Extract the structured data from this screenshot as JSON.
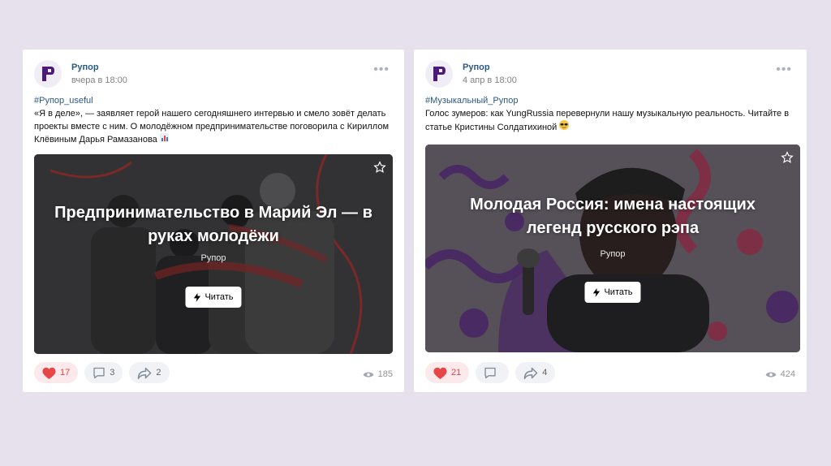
{
  "colors": {
    "accent": "#2a5885",
    "like": "#e64646",
    "brand": "#4b1a7a"
  },
  "posts": [
    {
      "author": "Рупор",
      "time": "вчера в 18:00",
      "hashtag": "#Рупор_useful",
      "text": "«Я в деле», — заявляет герой нашего сегодняшнего интервью и смело зовёт делать проекты вместе с ним. О молодёжном предпринимательстве поговорила с Кириллом Клёвиным Дарья Рамазанова",
      "emoji_icon": "bar-chart-icon",
      "article": {
        "title": "Предпринимательство в Марий Эл — в руках молодёжи",
        "source": "Рупор",
        "read_label": "Читать"
      },
      "likes": "17",
      "comments": "3",
      "shares": "2",
      "views": "185"
    },
    {
      "author": "Рупор",
      "time": "4 апр в 18:00",
      "hashtag": "#Музыкальный_Рупор",
      "text": "Голос зумеров: как YungRussia перевернули нашу музыкальную реальность. Читайте в статье Кристины Солдатихиной",
      "emoji_icon": "sunglasses-face-icon",
      "article": {
        "title": "Молодая Россия: имена настоящих легенд русского рэпа",
        "source": "Рупор",
        "read_label": "Читать"
      },
      "likes": "21",
      "comments": "",
      "shares": "4",
      "views": "424"
    }
  ]
}
